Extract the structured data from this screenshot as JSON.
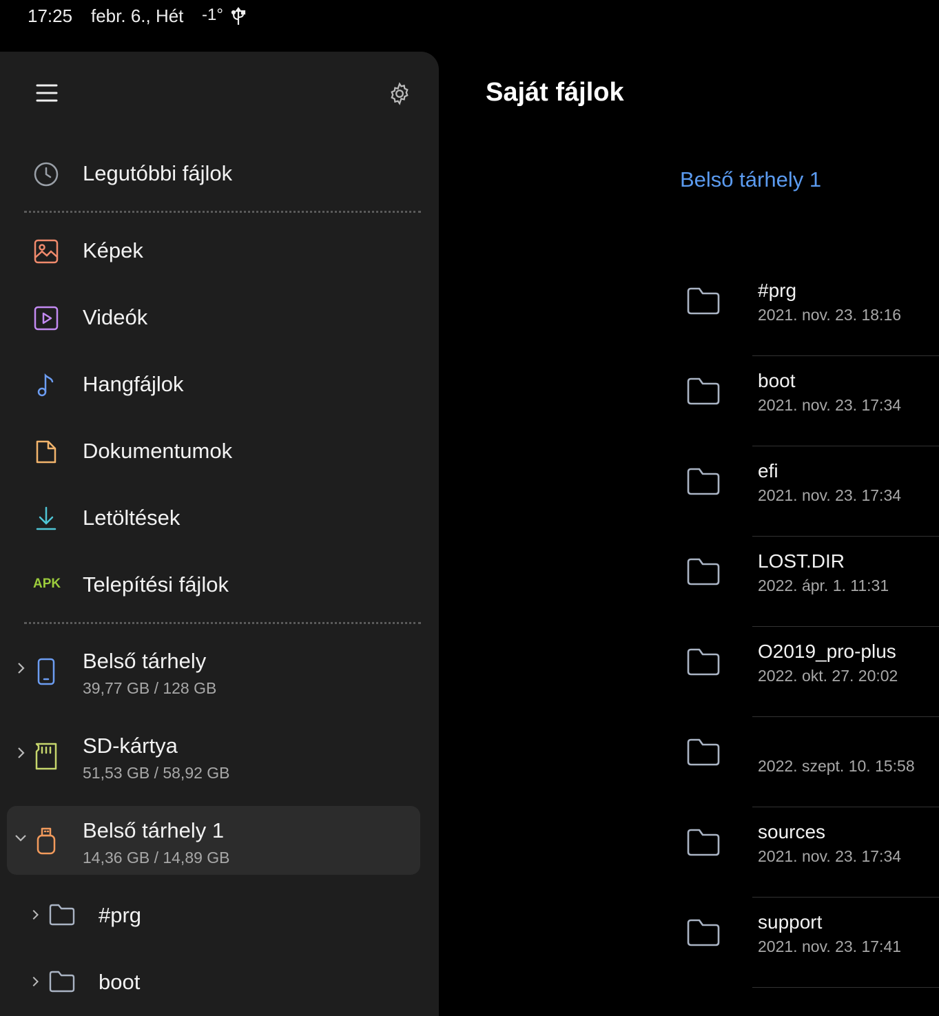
{
  "status_bar": {
    "time": "17:25",
    "date": "febr. 6., Hét",
    "temperature": "-1°",
    "usb_icon": "usb-icon"
  },
  "drawer": {
    "menu_icon": "hamburger-menu-icon",
    "settings_icon": "gear-icon",
    "recent": {
      "label": "Legutóbbi fájlok",
      "icon": "clock-icon"
    },
    "categories": [
      {
        "label": "Képek",
        "icon": "image-icon",
        "color": "#f08a6c"
      },
      {
        "label": "Videók",
        "icon": "video-icon",
        "color": "#c38af2"
      },
      {
        "label": "Hangfájlok",
        "icon": "music-note-icon",
        "color": "#6c9df2"
      },
      {
        "label": "Dokumentumok",
        "icon": "document-icon",
        "color": "#f2b46c"
      },
      {
        "label": "Letöltések",
        "icon": "download-icon",
        "color": "#4fc6d6"
      },
      {
        "label": "Telepítési fájlok",
        "icon": "apk-icon",
        "icon_text": "APK",
        "color": "#9ccc3c"
      }
    ],
    "storages": [
      {
        "name": "Belső tárhely",
        "size": "39,77 GB / 128 GB",
        "icon": "phone-icon",
        "color": "#6c9df2",
        "expanded": false
      },
      {
        "name": "SD-kártya",
        "size": "51,53 GB / 58,92 GB",
        "icon": "sd-card-icon",
        "color": "#c6d66c",
        "expanded": false
      },
      {
        "name": "Belső tárhely 1",
        "size": "14,36 GB / 14,89 GB",
        "icon": "usb-drive-icon",
        "color": "#f29a5c",
        "expanded": true
      }
    ],
    "subfolders": [
      {
        "name": "#prg"
      },
      {
        "name": "boot"
      }
    ]
  },
  "main": {
    "title": "Saját fájlok",
    "breadcrumb": "Belső tárhely 1",
    "files": [
      {
        "name": "#prg",
        "date": "2021. nov. 23. 18:16"
      },
      {
        "name": "boot",
        "date": "2021. nov. 23. 17:34"
      },
      {
        "name": "efi",
        "date": "2021. nov. 23. 17:34"
      },
      {
        "name": "LOST.DIR",
        "date": "2022. ápr. 1. 11:31"
      },
      {
        "name": "O2019_pro-plus",
        "date": "2022. okt. 27. 20:02"
      },
      {
        "name": "",
        "date": "2022. szept. 10. 15:58"
      },
      {
        "name": "sources",
        "date": "2021. nov. 23. 17:34"
      },
      {
        "name": "support",
        "date": "2021. nov. 23. 17:41"
      }
    ]
  }
}
